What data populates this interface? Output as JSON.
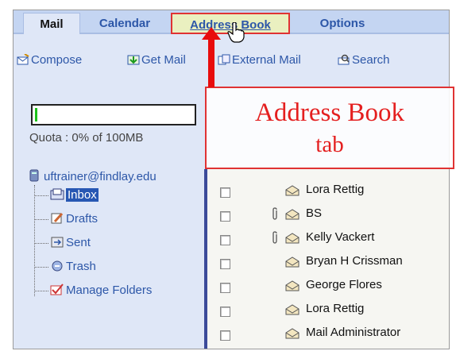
{
  "tabs": {
    "mail": "Mail",
    "calendar": "Calendar",
    "address_book": "Address Book",
    "options": "Options"
  },
  "toolbar": {
    "compose": "Compose",
    "get_mail": "Get Mail",
    "external_mail": "External Mail",
    "search": "Search"
  },
  "quota": {
    "text": "Quota : 0% of 100MB",
    "used_fraction": 0
  },
  "account": "uftrainer@findlay.edu",
  "folders": [
    "Inbox",
    "Drafts",
    "Sent",
    "Trash",
    "Manage Folders"
  ],
  "messages": [
    {
      "sender": "Lora Rettig",
      "attachment": false
    },
    {
      "sender": "BS",
      "attachment": true
    },
    {
      "sender": "Kelly Vackert",
      "attachment": true
    },
    {
      "sender": "Bryan H Crissman",
      "attachment": false
    },
    {
      "sender": "George Flores",
      "attachment": false
    },
    {
      "sender": "Lora Rettig",
      "attachment": false
    },
    {
      "sender": "Mail Administrator",
      "attachment": false
    }
  ],
  "callout": {
    "line1": "Address Book",
    "line2": "tab"
  },
  "colors": {
    "accent": "#2d57a8",
    "highlight": "#e03333",
    "selected": "#2757b3"
  }
}
